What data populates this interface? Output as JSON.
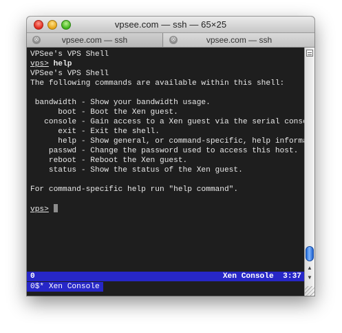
{
  "window": {
    "title": "vpsee.com — ssh — 65×25"
  },
  "tabs": [
    {
      "label": "vpsee.com — ssh",
      "close_glyph": "⊗"
    },
    {
      "label": "vpsee.com — ssh",
      "close_glyph": "⊗"
    }
  ],
  "terminal": {
    "l1": "VPSee's VPS Shell",
    "prompt": "vps>",
    "command": " help",
    "l3": "VPSee's VPS Shell",
    "l4": "The following commands are available within this shell:",
    "l5": "",
    "l6": " bandwidth - Show your bandwidth usage.",
    "l7": "      boot - Boot the Xen guest.",
    "l8": "   console - Gain access to a Xen guest via the serial console.",
    "l9": "      exit - Exit the shell.",
    "l10": "      help - Show general, or command-specific, help information.",
    "l11": "    passwd - Change the password used to access this host.",
    "l12": "    reboot - Reboot the Xen guest.",
    "l13": "    status - Show the status of the Xen guest.",
    "l14": "",
    "l15": "For command-specific help run \"help command\".",
    "l16": "",
    "current_prompt": "vps>"
  },
  "status_bar": {
    "left": "0",
    "window_name": "Xen Console",
    "time": "3:37",
    "window_list": "0$* Xen Console"
  },
  "colors": {
    "terminal_bg": "#1e1e1e",
    "status_bg": "#2727c7",
    "scroll_thumb": "#1e67d6"
  },
  "icons": {
    "split": "split-pane-icon",
    "scroll_up": "▲",
    "scroll_down": "▼"
  }
}
